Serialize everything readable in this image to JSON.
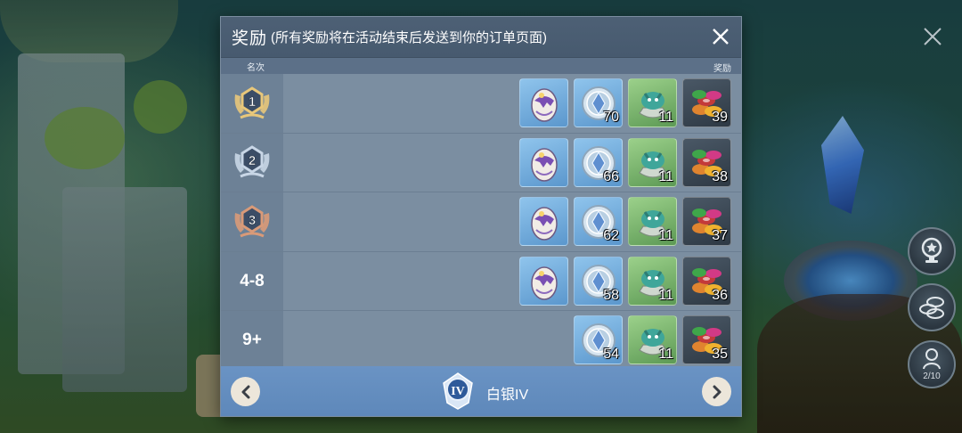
{
  "dialog": {
    "title": "奖励",
    "subtitle": "(所有奖励将在活动结束后发送到你的订单页面)",
    "columns": {
      "rank": "名次",
      "reward": "奖励"
    },
    "rows": [
      {
        "rank": "1",
        "medal": "gold",
        "items": [
          {
            "icon": "dragon-egg-icon",
            "qty": ""
          },
          {
            "icon": "silver-coin-icon",
            "qty": "70"
          },
          {
            "icon": "dragon-statue-icon",
            "qty": "11"
          },
          {
            "icon": "chips-pile-icon",
            "qty": "39"
          }
        ]
      },
      {
        "rank": "2",
        "medal": "silver",
        "items": [
          {
            "icon": "dragon-egg-icon",
            "qty": ""
          },
          {
            "icon": "silver-coin-icon",
            "qty": "66"
          },
          {
            "icon": "dragon-statue-icon",
            "qty": "11"
          },
          {
            "icon": "chips-pile-icon",
            "qty": "38"
          }
        ]
      },
      {
        "rank": "3",
        "medal": "bronze",
        "items": [
          {
            "icon": "dragon-egg-icon",
            "qty": ""
          },
          {
            "icon": "silver-coin-icon",
            "qty": "62"
          },
          {
            "icon": "dragon-statue-icon",
            "qty": "11"
          },
          {
            "icon": "chips-pile-icon",
            "qty": "37"
          }
        ]
      },
      {
        "rank": "4-8",
        "medal": "",
        "items": [
          {
            "icon": "dragon-egg-icon",
            "qty": ""
          },
          {
            "icon": "silver-coin-icon",
            "qty": "58"
          },
          {
            "icon": "dragon-statue-icon",
            "qty": "11"
          },
          {
            "icon": "chips-pile-icon",
            "qty": "36"
          }
        ]
      },
      {
        "rank": "9+",
        "medal": "",
        "items": [
          {
            "icon": "silver-coin-icon",
            "qty": "54"
          },
          {
            "icon": "dragon-statue-icon",
            "qty": "11"
          },
          {
            "icon": "chips-pile-icon",
            "qty": "35"
          }
        ]
      }
    ],
    "footer": {
      "tier_badge": "IV",
      "tier_name": "白银IV"
    }
  },
  "hud": {
    "pet_count": "2/10"
  },
  "colors": {
    "dialog_bg": "#5b6e82",
    "row_bg": "#7b8ea1",
    "footer_bg": "#6a93c4",
    "gold": "#e8c77a",
    "silver": "#c8d6e6",
    "bronze": "#d99a78"
  }
}
